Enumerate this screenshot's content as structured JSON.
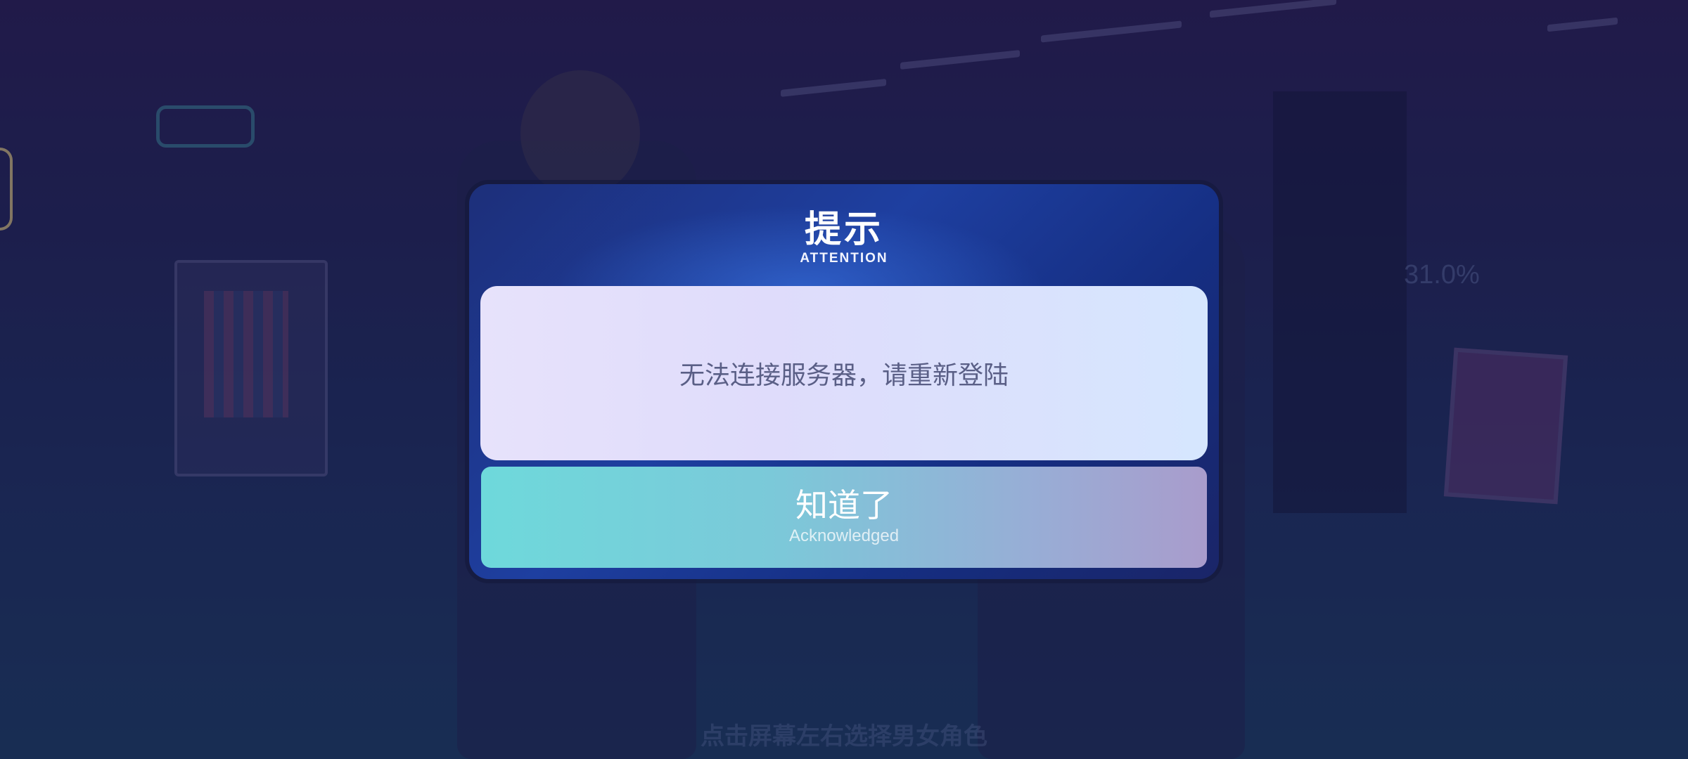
{
  "background": {
    "progress_percent": "31.0%",
    "bottom_hint": "点击屏幕左右选择男女角色"
  },
  "dialog": {
    "title": "提示",
    "subtitle": "ATTENTION",
    "message": "无法连接服务器，请重新登陆",
    "confirm_button": {
      "label": "知道了",
      "sublabel": "Acknowledged"
    }
  },
  "colors": {
    "button_start": "#6ed9db",
    "button_end": "#a99ccc",
    "message_box": "#e4e2fb",
    "dialog_bg": "#1e3fa0"
  }
}
